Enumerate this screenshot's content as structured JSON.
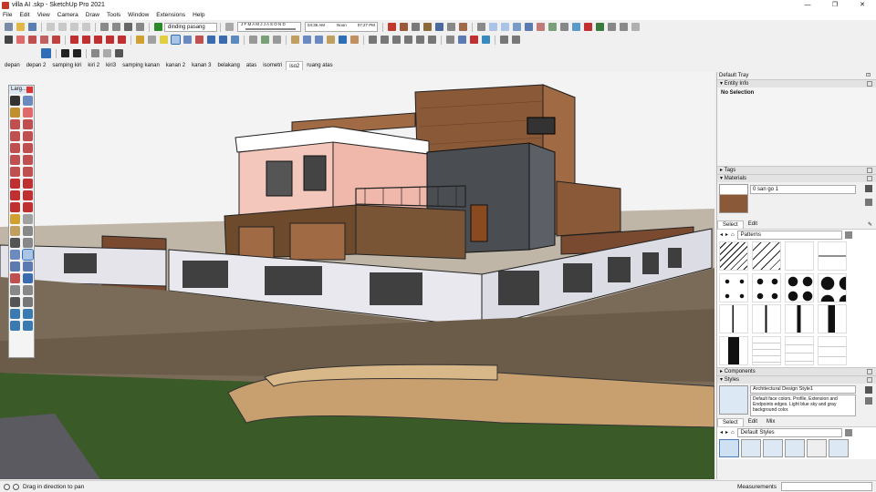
{
  "window": {
    "title": "villa AI .skp - SketchUp Pro 2021",
    "controls": [
      "—",
      "❐",
      "✕"
    ]
  },
  "menu": [
    "File",
    "Edit",
    "View",
    "Camera",
    "Draw",
    "Tools",
    "Window",
    "Extensions",
    "Help"
  ],
  "toolbar": {
    "layer_dropdown": "dinding pasang",
    "shadow_months": "J F M A M J J A S O N D",
    "time_start": "04:36 AM",
    "time_noon": "Noon",
    "time_end": "07:27 PM"
  },
  "scenes": [
    "depan",
    "depan 2",
    "samping kiri",
    "kiri 2",
    "kiri3",
    "samping kanan",
    "kanan 2",
    "kanan 3",
    "belakang",
    "atas",
    "isometri",
    "iso2",
    "ruang atas"
  ],
  "active_scene": "iso2",
  "palette": {
    "title": "Larg..."
  },
  "tray": {
    "title": "Default Tray",
    "entity_info": {
      "label": "Entity Info",
      "selection": "No Selection"
    },
    "tags": {
      "label": "Tags"
    },
    "materials": {
      "label": "Materials",
      "current": "0 san go 1",
      "tabs": [
        "Select",
        "Edit"
      ],
      "library": "Patterns"
    },
    "components": {
      "label": "Components"
    },
    "styles": {
      "label": "Styles",
      "name": "Architectural Design Style1",
      "description": "Default face colors. Profile, Extension and Endpoints edges. Light blue sky and gray background color.",
      "tabs": [
        "Select",
        "Edit",
        "Mix"
      ],
      "library": "Default Styles"
    }
  },
  "status": {
    "message": "Drag in direction to pan",
    "measurements_label": "Measurements"
  },
  "colors": {
    "accent_blue": "#2f6db5",
    "wall_pink": "#f4c7bd",
    "wood": "#8a5a38",
    "fence": "#e8e8ee",
    "grass": "#3a5a28"
  }
}
